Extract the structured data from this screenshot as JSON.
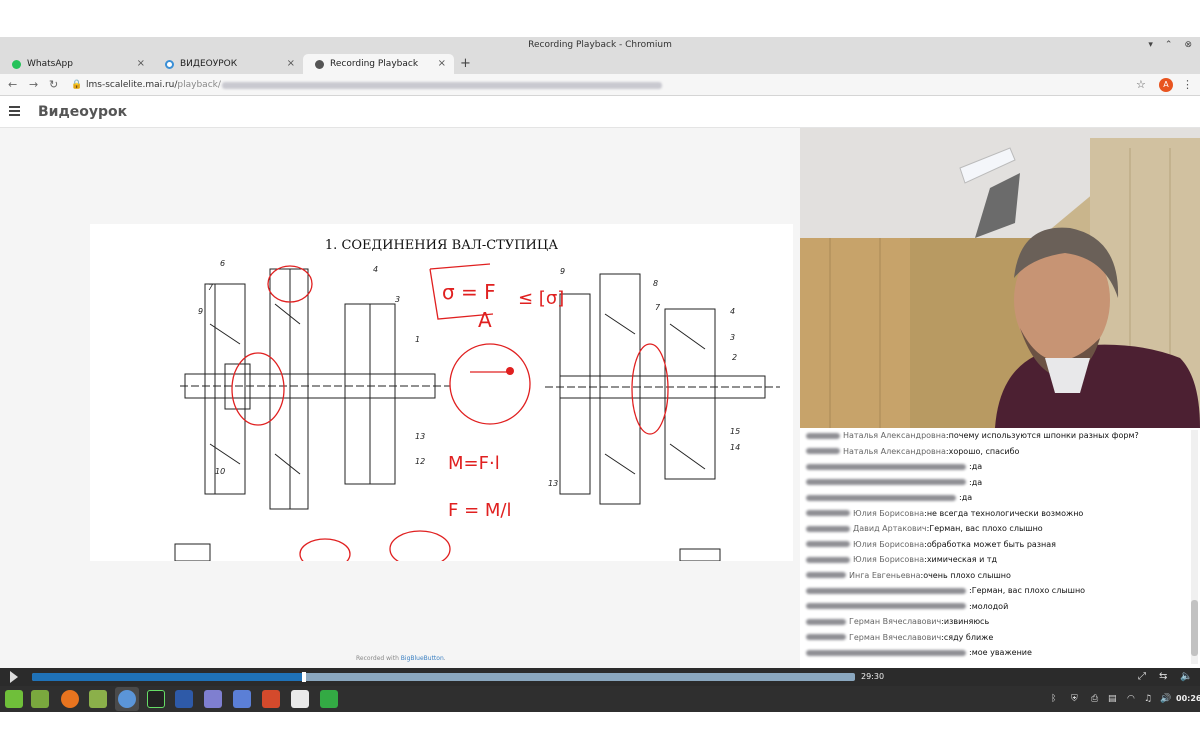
{
  "window": {
    "title": "Recording Playback - Chromium"
  },
  "tabs": [
    {
      "label": "WhatsApp",
      "icon": "whatsapp-icon"
    },
    {
      "label": "ВИДЕОУРОК",
      "icon": "globe-icon"
    },
    {
      "label": "Recording Playback",
      "icon": "chrome-icon"
    }
  ],
  "address_bar": {
    "host": "lms-scalelite.mai.ru/",
    "path": "playback/"
  },
  "profile_initial": "A",
  "app": {
    "title": "Видеоурок"
  },
  "slide": {
    "title": "1.   СОЕДИНЕНИЯ ВАЛ-СТУПИЦА"
  },
  "recorded_with": {
    "prefix": "Recorded with ",
    "link": "BigBlueButton",
    "suffix": "."
  },
  "chat": {
    "messages": [
      {
        "name": "Наталья Александровна",
        "text": "почему используются шпонки разных форм?"
      },
      {
        "name": "Наталья Александровна",
        "text": "хорошо, спасибо"
      },
      {
        "name": "",
        "text": "да"
      },
      {
        "name": "",
        "text": "да"
      },
      {
        "name": "",
        "text": "да"
      },
      {
        "name": "Юлия Борисовна",
        "text": "не всегда технологически возможно"
      },
      {
        "name": "Давид Артакович",
        "text": "Герман, вас плохо слышно"
      },
      {
        "name": "Юлия Борисовна",
        "text": "обработка может быть разная"
      },
      {
        "name": "Юлия Борисовна",
        "text": "химическая и тд"
      },
      {
        "name": "Инга Евгеньевна",
        "text": "очень плохо слышно"
      },
      {
        "name": "",
        "text": "Герман, вас плохо слышно"
      },
      {
        "name": "",
        "text": "молодой"
      },
      {
        "name": "Герман Вячеславович",
        "text": "извиняюсь"
      },
      {
        "name": "Герман Вячеславович",
        "text": "сяду ближе"
      },
      {
        "name": "",
        "text": "мое уважение"
      }
    ]
  },
  "player": {
    "time": "29:30",
    "progress": 0.331
  },
  "taskbar": {
    "clock": "00:26"
  },
  "colors": {
    "accent": "#1f72b8",
    "profile": "#e8541f",
    "annotation": "#e02020"
  }
}
